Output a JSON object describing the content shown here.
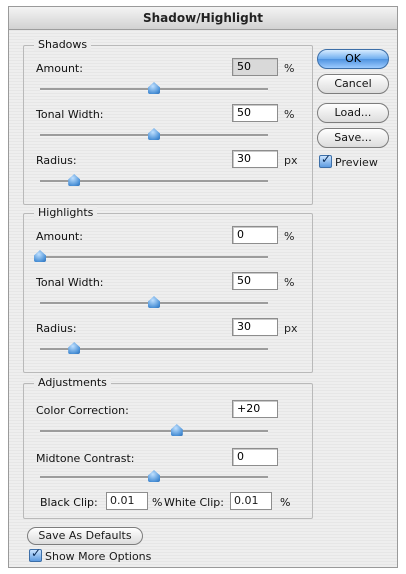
{
  "window": {
    "title": "Shadow/Highlight"
  },
  "shadows": {
    "legend": "Shadows",
    "amount": {
      "label": "Amount:",
      "value": "50",
      "unit": "%",
      "slider": 0.5
    },
    "tonal_width": {
      "label": "Tonal Width:",
      "value": "50",
      "unit": "%",
      "slider": 0.5
    },
    "radius": {
      "label": "Radius:",
      "value": "30",
      "unit": "px",
      "slider": 0.15
    }
  },
  "highlights": {
    "legend": "Highlights",
    "amount": {
      "label": "Amount:",
      "value": "0",
      "unit": "%",
      "slider": 0.0
    },
    "tonal_width": {
      "label": "Tonal Width:",
      "value": "50",
      "unit": "%",
      "slider": 0.5
    },
    "radius": {
      "label": "Radius:",
      "value": "30",
      "unit": "px",
      "slider": 0.15
    }
  },
  "adjustments": {
    "legend": "Adjustments",
    "color_correction": {
      "label": "Color Correction:",
      "value": "+20",
      "slider": 0.6
    },
    "midtone_contrast": {
      "label": "Midtone Contrast:",
      "value": "0",
      "slider": 0.5
    },
    "black_clip": {
      "label": "Black Clip:",
      "value": "0.01",
      "unit": "%"
    },
    "white_clip": {
      "label": "White Clip:",
      "value": "0.01",
      "unit": "%"
    }
  },
  "buttons": {
    "ok": "OK",
    "cancel": "Cancel",
    "load": "Load...",
    "save": "Save...",
    "save_defaults": "Save As Defaults"
  },
  "checkboxes": {
    "preview": {
      "label": "Preview",
      "checked": true
    },
    "show_more": {
      "label": "Show More Options",
      "checked": true
    }
  },
  "colors": {
    "accent": "#4f93e0",
    "dialog_bg": "#ececec"
  }
}
